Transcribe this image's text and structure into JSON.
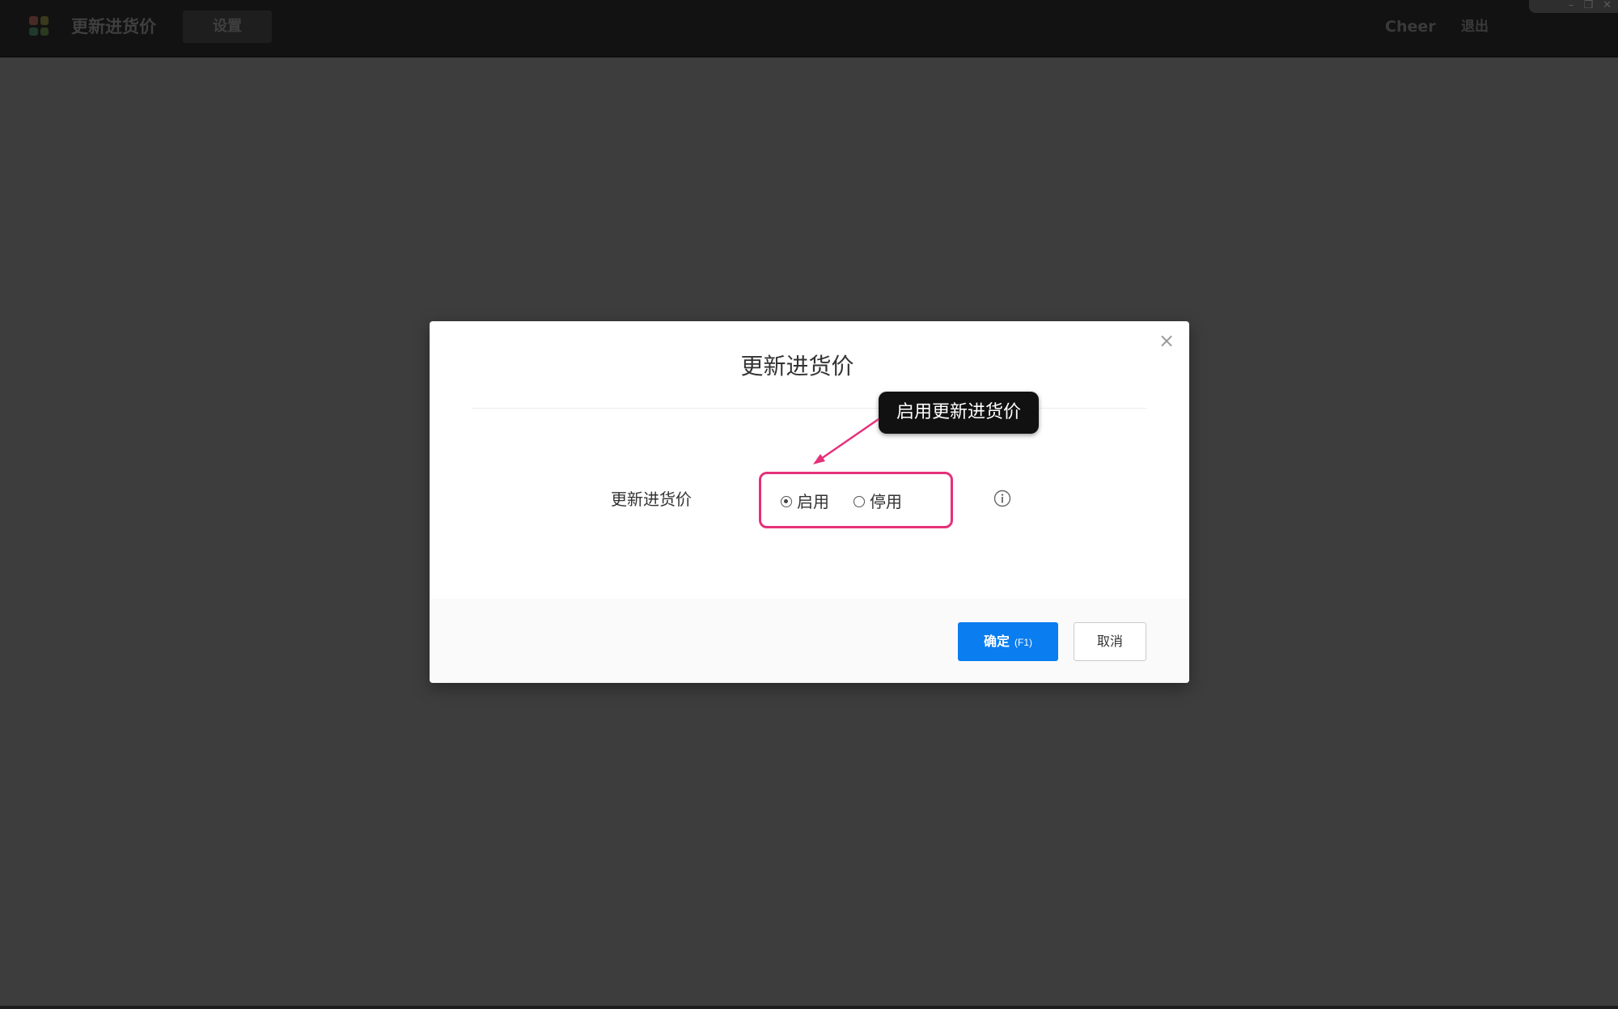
{
  "topbar": {
    "app_title": "更新进货价",
    "nav_tab": "设置",
    "user_name": "Cheer",
    "logout": "退出",
    "window_controls": [
      "–",
      "❐",
      "✕"
    ]
  },
  "dialog": {
    "title": "更新进货价",
    "close_glyph": "×",
    "field_label": "更新进货价",
    "options": [
      {
        "label": "启用",
        "checked": true
      },
      {
        "label": "停用",
        "checked": false
      }
    ],
    "confirm_label": "确定",
    "confirm_shortcut": "(F1)",
    "cancel_label": "取消"
  },
  "annotation": {
    "callout_text": "启用更新进货价",
    "highlight_color": "#e6307a"
  },
  "colors": {
    "primary": "#0a7df0",
    "background": "#3d3d3d",
    "topbar": "#121212"
  }
}
